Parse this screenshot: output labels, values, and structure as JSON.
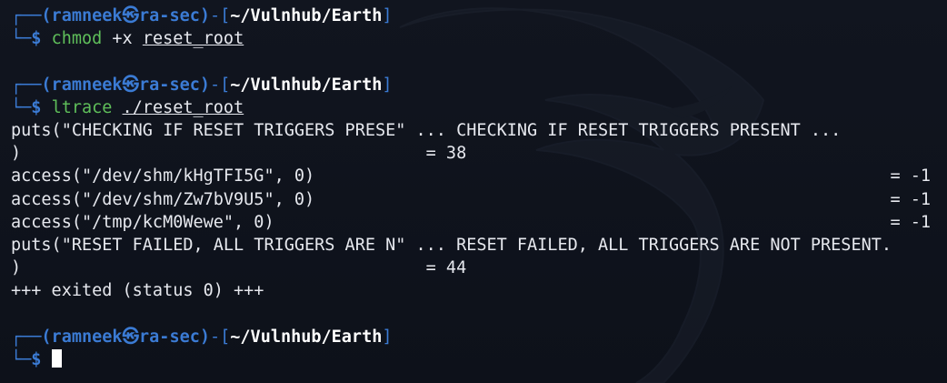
{
  "prompts": [
    {
      "user_host": "(ramneek㉿ra-sec)",
      "path": "~/Vulnhub/Earth",
      "command": "chmod",
      "flag": "+x",
      "argument": "reset_root"
    },
    {
      "user_host": "(ramneek㉿ra-sec)",
      "path": "~/Vulnhub/Earth",
      "command": "ltrace",
      "flag": "",
      "argument": "./reset_root"
    },
    {
      "user_host": "(ramneek㉿ra-sec)",
      "path": "~/Vulnhub/Earth",
      "command": "",
      "flag": "",
      "argument": ""
    }
  ],
  "prompt_chars": {
    "top_open": "┌──",
    "dash": "-",
    "bracket_open": "[",
    "bracket_close": "]",
    "bottom": "└─",
    "dollar": "$"
  },
  "ltrace_output": [
    {
      "text": "puts(\"CHECKING IF RESET TRIGGERS PRESE\" ... CHECKING IF RESET TRIGGERS PRESENT ...",
      "result": ""
    },
    {
      "text": ")                                        = 38",
      "result": ""
    },
    {
      "text": "access(\"/dev/shm/kHgTFI5G\", 0)",
      "result": "= -1"
    },
    {
      "text": "access(\"/dev/shm/Zw7bV9U5\", 0)",
      "result": "= -1"
    },
    {
      "text": "access(\"/tmp/kcM0Wewe\", 0)",
      "result": "= -1"
    },
    {
      "text": "puts(\"RESET FAILED, ALL TRIGGERS ARE N\" ... RESET FAILED, ALL TRIGGERS ARE NOT PRESENT.",
      "result": ""
    },
    {
      "text": ")                                        = 44",
      "result": ""
    },
    {
      "text": "+++ exited (status 0) +++",
      "result": ""
    }
  ],
  "colors": {
    "background": "#0e121b",
    "prompt_blue": "#3b7bd4",
    "command_green": "#5fbf5a",
    "text": "#e6e8ee"
  },
  "icons": {
    "background_logo": "kali-dragon-icon",
    "cursor": "block-cursor"
  }
}
